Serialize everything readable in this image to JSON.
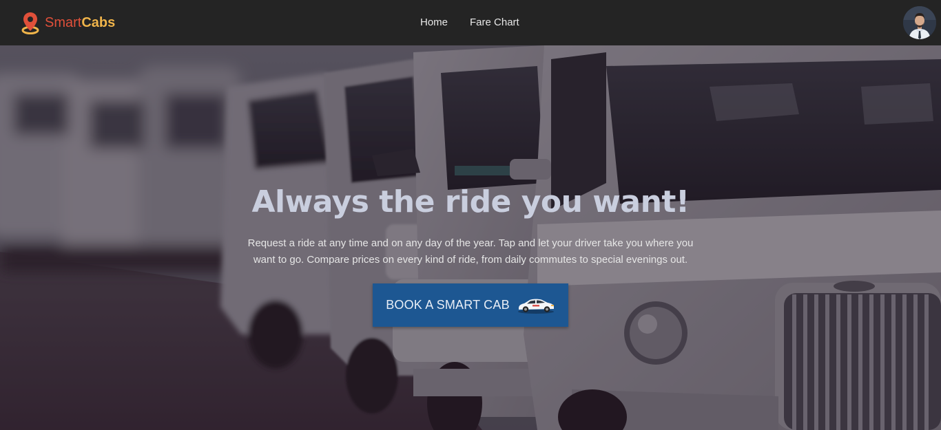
{
  "brand": {
    "smart": "Smart",
    "cabs": "Cabs",
    "icon": "location-pin-icon"
  },
  "nav": {
    "items": [
      {
        "label": "Home"
      },
      {
        "label": "Fare Chart"
      }
    ]
  },
  "profile": {
    "avatar": "user-avatar"
  },
  "hero": {
    "title": "Always the ride you want!",
    "description": "Request a ride at any time and on any day of the year. Tap and let your driver take you where you want to go. Compare prices on every kind of ride, from daily commutes to special evenings out.",
    "cta_label": "BOOK A SMART CAB",
    "cta_icon": "car-icon",
    "background": "blurred-row-of-taxis-photo"
  },
  "colors": {
    "navbar": "#242424",
    "brand_smart": "#e0503a",
    "brand_cabs": "#f0b44a",
    "cta": "#1d5792",
    "hero_title": "#c9cede"
  }
}
